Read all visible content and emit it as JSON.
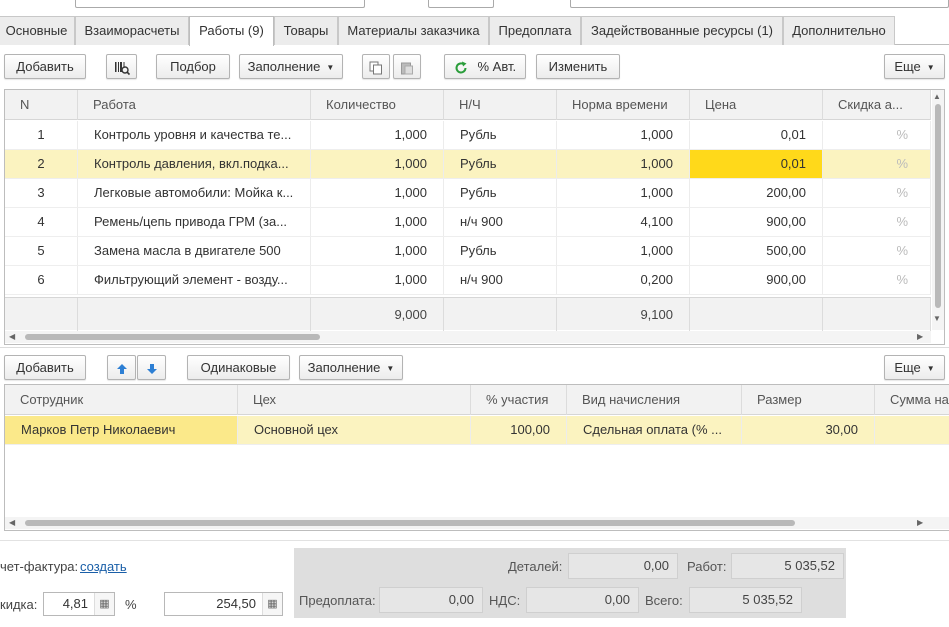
{
  "tabs": [
    {
      "label": "Основные"
    },
    {
      "label": "Взаиморасчеты"
    },
    {
      "label": "Работы (9)"
    },
    {
      "label": "Товары"
    },
    {
      "label": "Материалы заказчика"
    },
    {
      "label": "Предоплата"
    },
    {
      "label": "Задействованные ресурсы (1)"
    },
    {
      "label": "Дополнительно"
    }
  ],
  "works_toolbar": {
    "add": "Добавить",
    "pick": "Подбор",
    "fill": "Заполнение",
    "auto_percent": "% Авт.",
    "change": "Изменить",
    "more": "Еще"
  },
  "works_table": {
    "columns": [
      "N",
      "Работа",
      "Количество",
      "Н/Ч",
      "Норма времени",
      "Цена",
      "Скидка а..."
    ],
    "rows": [
      {
        "n": "1",
        "work": "Контроль уровня и качества те...",
        "qty": "1,000",
        "unit": "Рубль",
        "norm": "1,000",
        "price": "0,01",
        "disc": "%"
      },
      {
        "n": "2",
        "work": "Контроль давления, вкл.подка...",
        "qty": "1,000",
        "unit": "Рубль",
        "norm": "1,000",
        "price": "0,01",
        "disc": "%"
      },
      {
        "n": "3",
        "work": "Легковые автомобили: Мойка к...",
        "qty": "1,000",
        "unit": "Рубль",
        "norm": "1,000",
        "price": "200,00",
        "disc": "%"
      },
      {
        "n": "4",
        "work": "Ремень/цепь привода ГРМ (за...",
        "qty": "1,000",
        "unit": "н/ч 900",
        "norm": "4,100",
        "price": "900,00",
        "disc": "%"
      },
      {
        "n": "5",
        "work": "Замена масла в двигателе 500",
        "qty": "1,000",
        "unit": "Рубль",
        "norm": "1,000",
        "price": "500,00",
        "disc": "%"
      },
      {
        "n": "6",
        "work": "Фильтрующий элемент - возду...",
        "qty": "1,000",
        "unit": "н/ч 900",
        "norm": "0,200",
        "price": "900,00",
        "disc": "%"
      }
    ],
    "footer": {
      "qty": "9,000",
      "norm": "9,100"
    }
  },
  "staff_toolbar": {
    "add": "Добавить",
    "same": "Одинаковые",
    "fill": "Заполнение",
    "more": "Еще"
  },
  "staff_table": {
    "columns": [
      "Сотрудник",
      "Цех",
      "% участия",
      "Вид начисления",
      "Размер",
      "Сумма на"
    ],
    "rows": [
      {
        "employee": "Марков Петр Николаевич",
        "shop": "Основной цех",
        "share": "100,00",
        "accrual": "Сдельная оплата (% ...",
        "size": "30,00",
        "sum": ""
      }
    ]
  },
  "bottom": {
    "invoice_label": "чет-фактура:",
    "invoice_link": "создать",
    "discount_label": "кидка:",
    "discount_value": "4,81",
    "percent_sign": "%",
    "discount_sum": "254,50"
  },
  "totals": {
    "details_label": "Деталей:",
    "details_value": "0,00",
    "works_label": "Работ:",
    "works_value": "5 035,52",
    "prepay_label": "Предоплата:",
    "prepay_value": "0,00",
    "vat_label": "НДС:",
    "vat_value": "0,00",
    "total_label": "Всего:",
    "total_value": "5 035,52"
  },
  "colors": {
    "selected_row": "#fbf3c0",
    "highlight_cell": "#ffd91a",
    "link": "#1a5fa8",
    "refresh_icon": "#2a9d3a",
    "arrow_icon": "#2d7fd4"
  }
}
